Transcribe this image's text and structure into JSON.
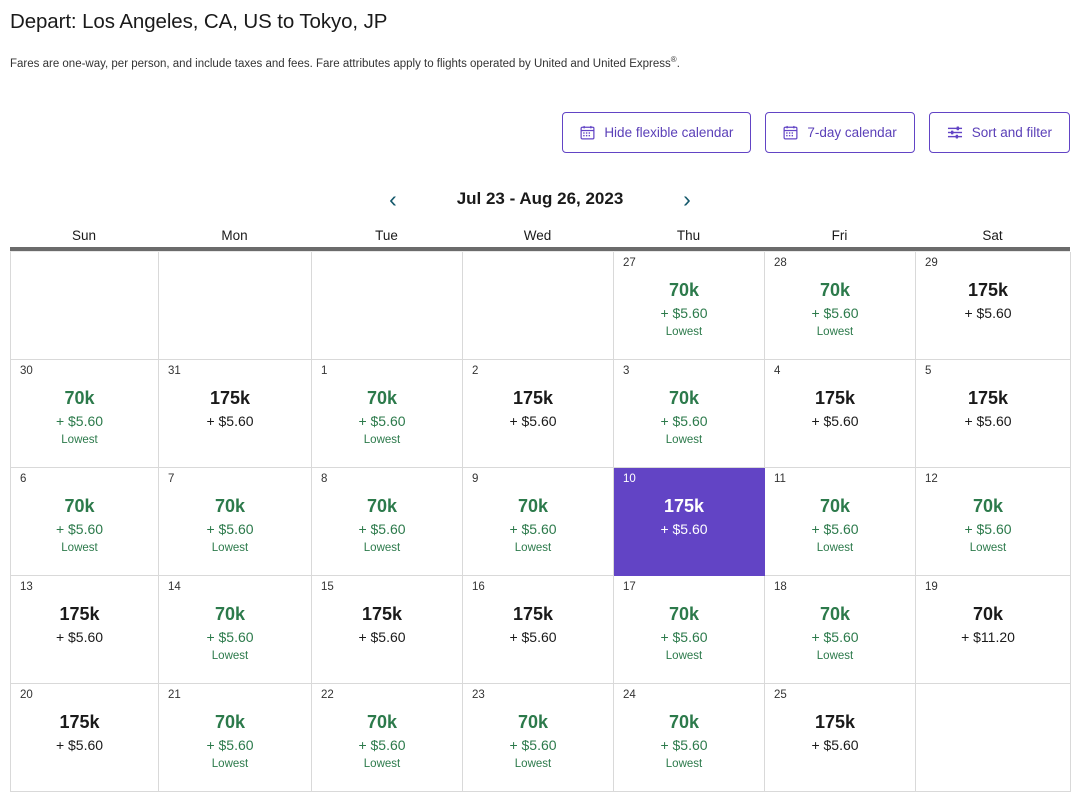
{
  "header": {
    "title": "Depart: Los Angeles, CA, US to Tokyo, JP",
    "note_part1": "Fares are one-way, per person, and include taxes and fees. Fare attributes apply to flights operated by United and United Express",
    "note_sup": "®",
    "note_end": "."
  },
  "toolbar": {
    "hide_flexible_calendar": "Hide flexible calendar",
    "seven_day_calendar": "7-day calendar",
    "sort_and_filter": "Sort and filter",
    "accent_color": "#6244c5"
  },
  "datenav": {
    "prev_label": "‹",
    "next_label": "›",
    "range": "Jul 23 - Aug 26, 2023"
  },
  "calendar": {
    "weekdays": [
      "Sun",
      "Mon",
      "Tue",
      "Wed",
      "Thu",
      "Fri",
      "Sat"
    ],
    "lowest_label": "Lowest",
    "lowest_color": "#2c7a4b",
    "selected_bg": "#6244c5",
    "cells": [
      {
        "day": "",
        "empty": true
      },
      {
        "day": "",
        "empty": true
      },
      {
        "day": "",
        "empty": true
      },
      {
        "day": "",
        "empty": true
      },
      {
        "day": "27",
        "miles": "70k",
        "tax": "+ $5.60",
        "lowest": "Lowest",
        "low": true
      },
      {
        "day": "28",
        "miles": "70k",
        "tax": "+ $5.60",
        "lowest": "Lowest",
        "low": true
      },
      {
        "day": "29",
        "miles": "175k",
        "tax": "+ $5.60",
        "lowest": "",
        "low": false
      },
      {
        "day": "30",
        "miles": "70k",
        "tax": "+ $5.60",
        "lowest": "Lowest",
        "low": true
      },
      {
        "day": "31",
        "miles": "175k",
        "tax": "+ $5.60",
        "lowest": "",
        "low": false
      },
      {
        "day": "1",
        "miles": "70k",
        "tax": "+ $5.60",
        "lowest": "Lowest",
        "low": true
      },
      {
        "day": "2",
        "miles": "175k",
        "tax": "+ $5.60",
        "lowest": "",
        "low": false
      },
      {
        "day": "3",
        "miles": "70k",
        "tax": "+ $5.60",
        "lowest": "Lowest",
        "low": true
      },
      {
        "day": "4",
        "miles": "175k",
        "tax": "+ $5.60",
        "lowest": "",
        "low": false
      },
      {
        "day": "5",
        "miles": "175k",
        "tax": "+ $5.60",
        "lowest": "",
        "low": false
      },
      {
        "day": "6",
        "miles": "70k",
        "tax": "+ $5.60",
        "lowest": "Lowest",
        "low": true
      },
      {
        "day": "7",
        "miles": "70k",
        "tax": "+ $5.60",
        "lowest": "Lowest",
        "low": true
      },
      {
        "day": "8",
        "miles": "70k",
        "tax": "+ $5.60",
        "lowest": "Lowest",
        "low": true
      },
      {
        "day": "9",
        "miles": "70k",
        "tax": "+ $5.60",
        "lowest": "Lowest",
        "low": true
      },
      {
        "day": "10",
        "miles": "175k",
        "tax": "+ $5.60",
        "lowest": "",
        "low": false,
        "selected": true
      },
      {
        "day": "11",
        "miles": "70k",
        "tax": "+ $5.60",
        "lowest": "Lowest",
        "low": true
      },
      {
        "day": "12",
        "miles": "70k",
        "tax": "+ $5.60",
        "lowest": "Lowest",
        "low": true
      },
      {
        "day": "13",
        "miles": "175k",
        "tax": "+ $5.60",
        "lowest": "",
        "low": false
      },
      {
        "day": "14",
        "miles": "70k",
        "tax": "+ $5.60",
        "lowest": "Lowest",
        "low": true
      },
      {
        "day": "15",
        "miles": "175k",
        "tax": "+ $5.60",
        "lowest": "",
        "low": false
      },
      {
        "day": "16",
        "miles": "175k",
        "tax": "+ $5.60",
        "lowest": "",
        "low": false
      },
      {
        "day": "17",
        "miles": "70k",
        "tax": "+ $5.60",
        "lowest": "Lowest",
        "low": true
      },
      {
        "day": "18",
        "miles": "70k",
        "tax": "+ $5.60",
        "lowest": "Lowest",
        "low": true
      },
      {
        "day": "19",
        "miles": "70k",
        "tax": "+ $11.20",
        "lowest": "",
        "low": false
      },
      {
        "day": "20",
        "miles": "175k",
        "tax": "+ $5.60",
        "lowest": "",
        "low": false
      },
      {
        "day": "21",
        "miles": "70k",
        "tax": "+ $5.60",
        "lowest": "Lowest",
        "low": true
      },
      {
        "day": "22",
        "miles": "70k",
        "tax": "+ $5.60",
        "lowest": "Lowest",
        "low": true
      },
      {
        "day": "23",
        "miles": "70k",
        "tax": "+ $5.60",
        "lowest": "Lowest",
        "low": true
      },
      {
        "day": "24",
        "miles": "70k",
        "tax": "+ $5.60",
        "lowest": "Lowest",
        "low": true
      },
      {
        "day": "25",
        "miles": "175k",
        "tax": "+ $5.60",
        "lowest": "",
        "low": false
      },
      {
        "day": "",
        "empty": true
      }
    ]
  },
  "icons": {
    "calendar": "calendar-icon",
    "filter": "filter-sliders-icon"
  }
}
